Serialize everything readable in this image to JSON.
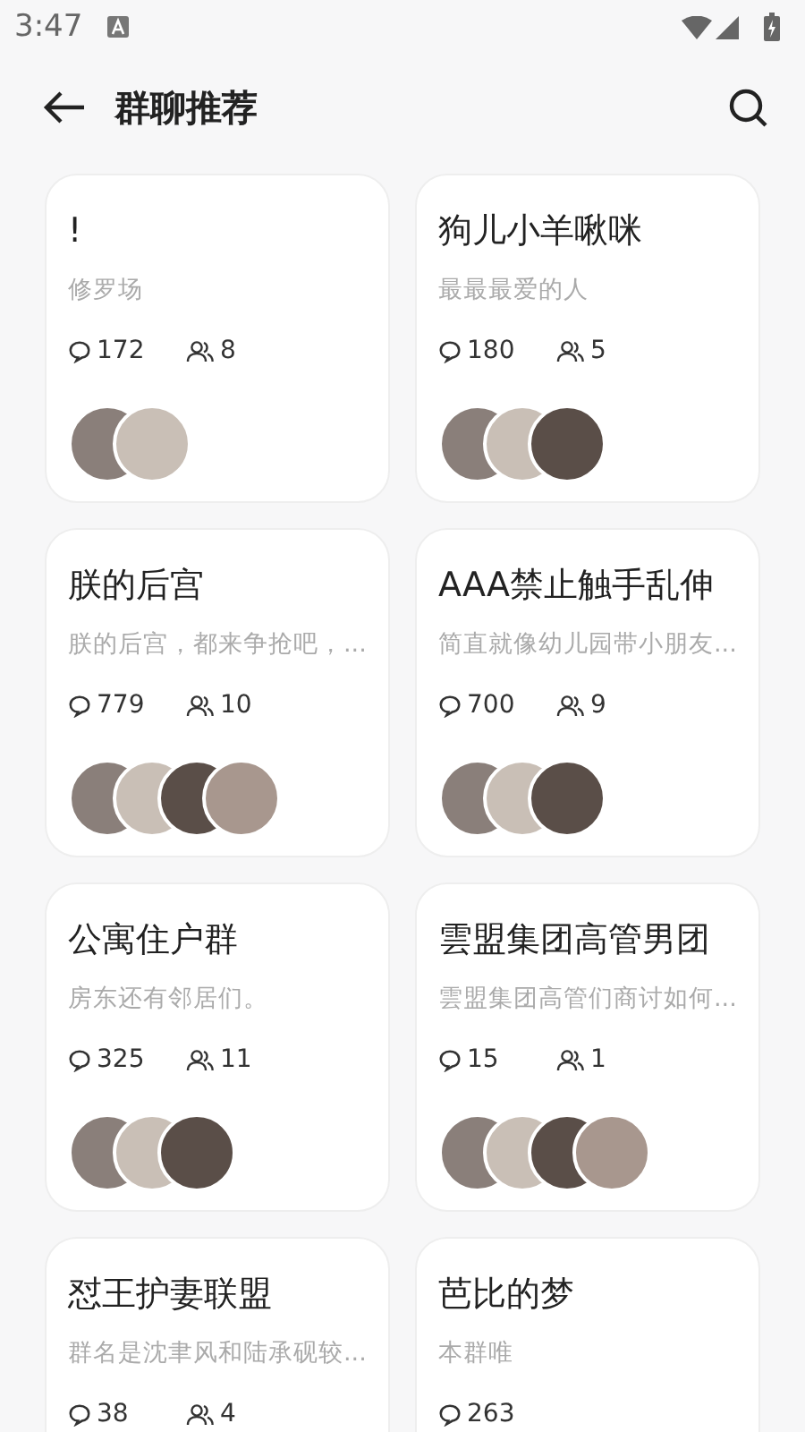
{
  "status_bar": {
    "time": "3:47"
  },
  "header": {
    "title": "群聊推荐"
  },
  "groups": [
    {
      "name": "!",
      "description": "修罗场",
      "messages": "172",
      "members": "8",
      "avatars": [
        {
          "kind": "photo"
        },
        {
          "kind": "photo"
        }
      ]
    },
    {
      "name": "狗儿小羊啾咪",
      "description": "最最最爱的人",
      "messages": "180",
      "members": "5",
      "avatars": [
        {
          "kind": "photo"
        },
        {
          "kind": "photo"
        },
        {
          "kind": "photo"
        }
      ]
    },
    {
      "name": "朕的后宫",
      "description": "朕的后宫，都来争抢吧，...",
      "messages": "779",
      "members": "10",
      "avatars": [
        {
          "kind": "photo"
        },
        {
          "kind": "photo"
        },
        {
          "kind": "photo"
        },
        {
          "kind": "photo"
        }
      ]
    },
    {
      "name": "AAA禁止触手乱伸",
      "description": "简直就像幼儿园带小朋友...",
      "messages": "700",
      "members": "9",
      "avatars": [
        {
          "kind": "photo"
        },
        {
          "kind": "photo"
        },
        {
          "kind": "photo"
        }
      ]
    },
    {
      "name": "公寓住户群",
      "description": "房东还有邻居们。",
      "messages": "325",
      "members": "11",
      "avatars": [
        {
          "kind": "photo"
        },
        {
          "kind": "photo"
        },
        {
          "kind": "photo"
        }
      ]
    },
    {
      "name": "雲盟集团高管男团",
      "description": "雲盟集团高管们商讨如何...",
      "messages": "15",
      "members": "1",
      "avatars": [
        {
          "kind": "photo"
        },
        {
          "kind": "photo"
        },
        {
          "kind": "photo"
        },
        {
          "kind": "photo"
        }
      ]
    },
    {
      "name": "怼王护妻联盟",
      "description": "群名是沈聿风和陆承砚较...",
      "messages": "38",
      "members": "4"
    },
    {
      "name": "芭比的梦",
      "description": "本群唯",
      "messages": "263"
    }
  ]
}
